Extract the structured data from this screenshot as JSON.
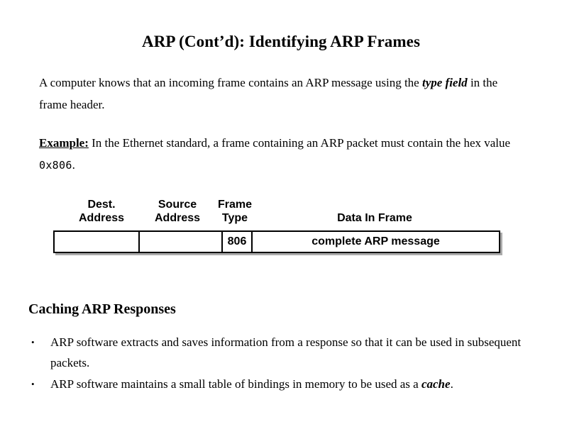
{
  "slide": {
    "title": "ARP (Cont’d): Identifying ARP Frames",
    "intro": {
      "text_before": "A computer knows that an incoming frame contains an ARP message using the ",
      "emphasis": "type field",
      "text_after": " in the frame header."
    },
    "example": {
      "label": "Example:",
      "text_before": " In the Ethernet standard, a frame containing an ARP packet must contain the hex value ",
      "hex_value": "0x806",
      "text_after": "."
    },
    "diagram": {
      "name": "ethernet-frame-diagram",
      "labels": {
        "dest_address": "Dest.\nAddress",
        "source_address": "Source\nAddress",
        "frame_type": "Frame\nType",
        "data_in_frame": "Data In Frame"
      },
      "cells": [
        {
          "name": "dest-address-cell",
          "value": ""
        },
        {
          "name": "source-address-cell",
          "value": ""
        },
        {
          "name": "frame-type-cell",
          "value": "806"
        },
        {
          "name": "data-cell",
          "value": "complete ARP message"
        }
      ]
    },
    "section_heading": "Caching ARP Responses",
    "bullet_marker": "•",
    "bullets": [
      {
        "text_before": "ARP software extracts and saves information from a response so that it can be used in subsequent packets.",
        "emphasis": "",
        "text_after": ""
      },
      {
        "text_before": "ARP software maintains a small table of bindings in memory to be used as a ",
        "emphasis": "cache",
        "text_after": "."
      }
    ]
  },
  "colors": {
    "background": "#ffffff",
    "text": "#000000",
    "border": "#000000"
  }
}
